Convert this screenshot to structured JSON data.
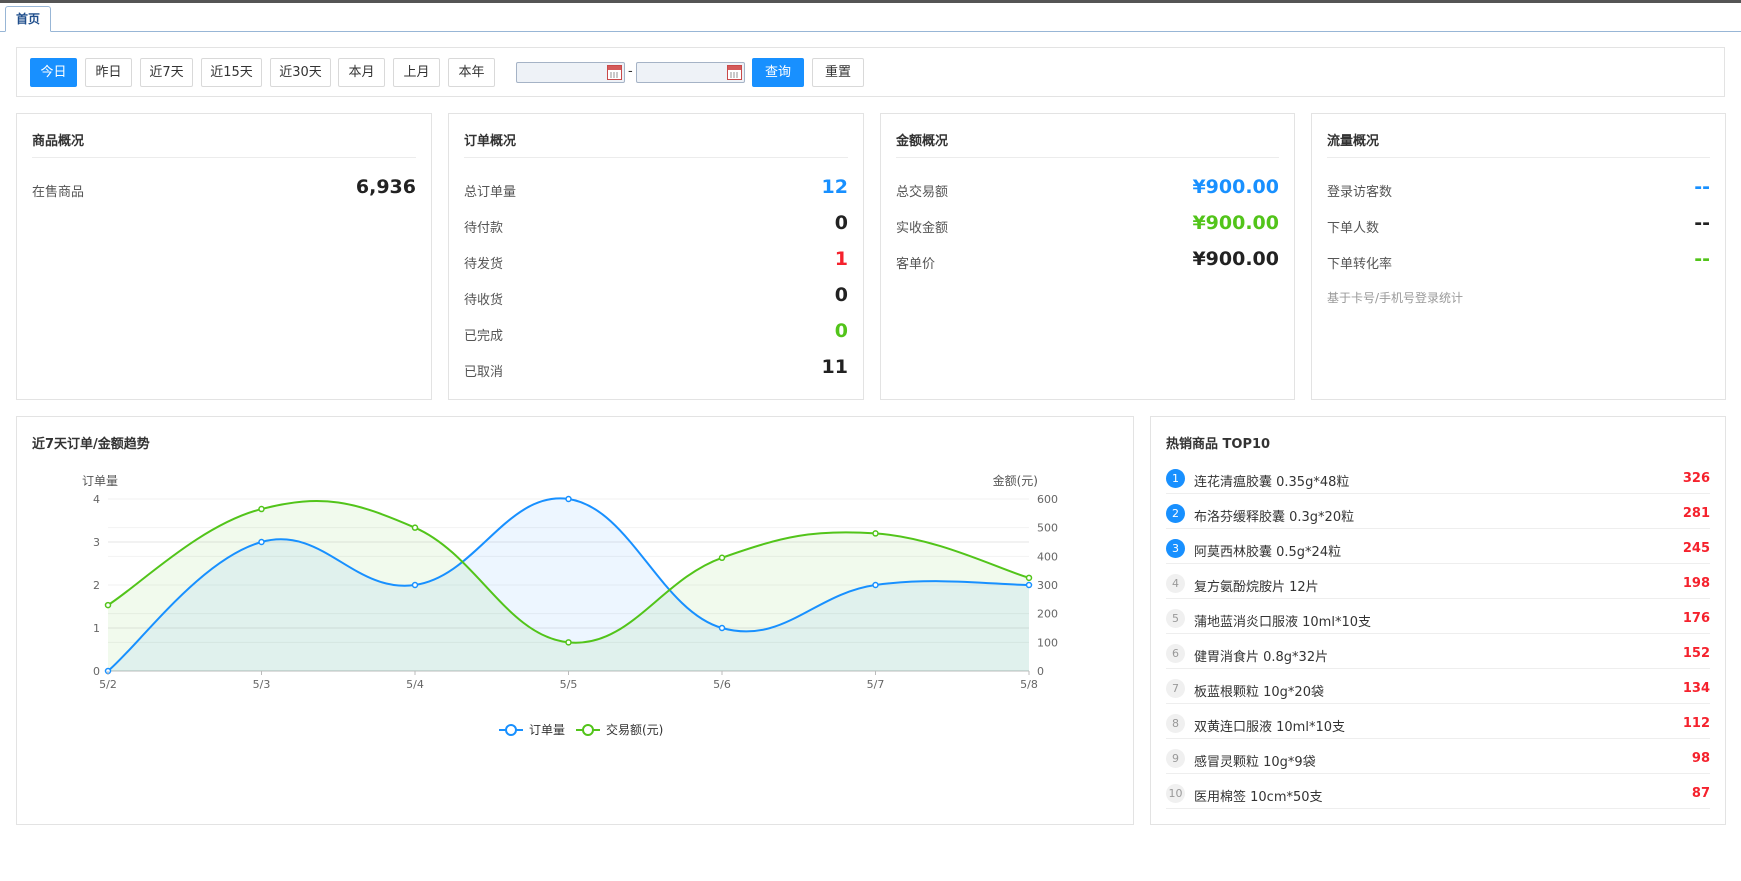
{
  "tabs": [
    {
      "label": "首页"
    }
  ],
  "filter": {
    "buttons": [
      "今日",
      "昨日",
      "近7天",
      "近15天",
      "近30天",
      "本月",
      "上月",
      "本年"
    ],
    "date_separator": "-",
    "query_label": "查询",
    "reset_label": "重置"
  },
  "cards": {
    "goods": {
      "title": "商品概况",
      "rows": [
        {
          "label": "在售商品",
          "value": "6,936"
        }
      ]
    },
    "orders": {
      "title": "订单概况",
      "rows": [
        {
          "label": "总订单量",
          "value": "12"
        },
        {
          "label": "待付款",
          "value": "0"
        },
        {
          "label": "待发货",
          "value": "1"
        },
        {
          "label": "待收货",
          "value": "0"
        },
        {
          "label": "已完成",
          "value": "0"
        },
        {
          "label": "已取消",
          "value": "11"
        }
      ]
    },
    "amount": {
      "title": "金额概况",
      "rows": [
        {
          "label": "总交易额",
          "value": "¥900.00"
        },
        {
          "label": "实收金额",
          "value": "¥900.00"
        },
        {
          "label": "客单价",
          "value": "¥900.00"
        }
      ]
    },
    "traffic": {
      "title": "流量概况",
      "rows": [
        {
          "label": "登录访客数",
          "value": "--"
        },
        {
          "label": "下单人数",
          "value": "--"
        },
        {
          "label": "下单转化率",
          "value": "--"
        }
      ],
      "note": "基于卡号/手机号登录统计"
    }
  },
  "colors": {
    "blue": "#1890ff",
    "green": "#52c41a",
    "red": "#f5222d"
  },
  "chart_title": "近7天订单/金额趋势",
  "chart_data": {
    "type": "line",
    "categories": [
      "5/2",
      "5/3",
      "5/4",
      "5/5",
      "5/6",
      "5/7",
      "5/8"
    ],
    "ylabel": "订单量",
    "y2label": "金额(元)",
    "ylim": [
      0,
      4
    ],
    "yticks": [
      0,
      1,
      2,
      3,
      4
    ],
    "y2lim": [
      0,
      600
    ],
    "y2ticks": [
      0,
      100,
      200,
      300,
      400,
      500,
      600
    ],
    "series": [
      {
        "name": "订单量",
        "axis": "left",
        "color": "#1890ff",
        "values": [
          0,
          3,
          2,
          4,
          1,
          2,
          2
        ]
      },
      {
        "name": "交易额(元)",
        "axis": "right",
        "color": "#52c41a",
        "values": [
          230,
          565,
          500,
          100,
          395,
          480,
          325
        ]
      }
    ],
    "smooth": true,
    "area": true,
    "grid": true,
    "legend": "bottom-center"
  },
  "top10": {
    "title": "热销商品 TOP10",
    "items": [
      {
        "rank": "1",
        "name": "连花清瘟胶囊 0.35g*48粒",
        "count": "326"
      },
      {
        "rank": "2",
        "name": "布洛芬缓释胶囊 0.3g*20粒",
        "count": "281"
      },
      {
        "rank": "3",
        "name": "阿莫西林胶囊 0.5g*24粒",
        "count": "245"
      },
      {
        "rank": "4",
        "name": "复方氨酚烷胺片 12片",
        "count": "198"
      },
      {
        "rank": "5",
        "name": "蒲地蓝消炎口服液 10ml*10支",
        "count": "176"
      },
      {
        "rank": "6",
        "name": "健胃消食片 0.8g*32片",
        "count": "152"
      },
      {
        "rank": "7",
        "name": "板蓝根颗粒 10g*20袋",
        "count": "134"
      },
      {
        "rank": "8",
        "name": "双黄连口服液 10ml*10支",
        "count": "112"
      },
      {
        "rank": "9",
        "name": "感冒灵颗粒 10g*9袋",
        "count": "98"
      },
      {
        "rank": "10",
        "name": "医用棉签 10cm*50支",
        "count": "87"
      }
    ]
  }
}
